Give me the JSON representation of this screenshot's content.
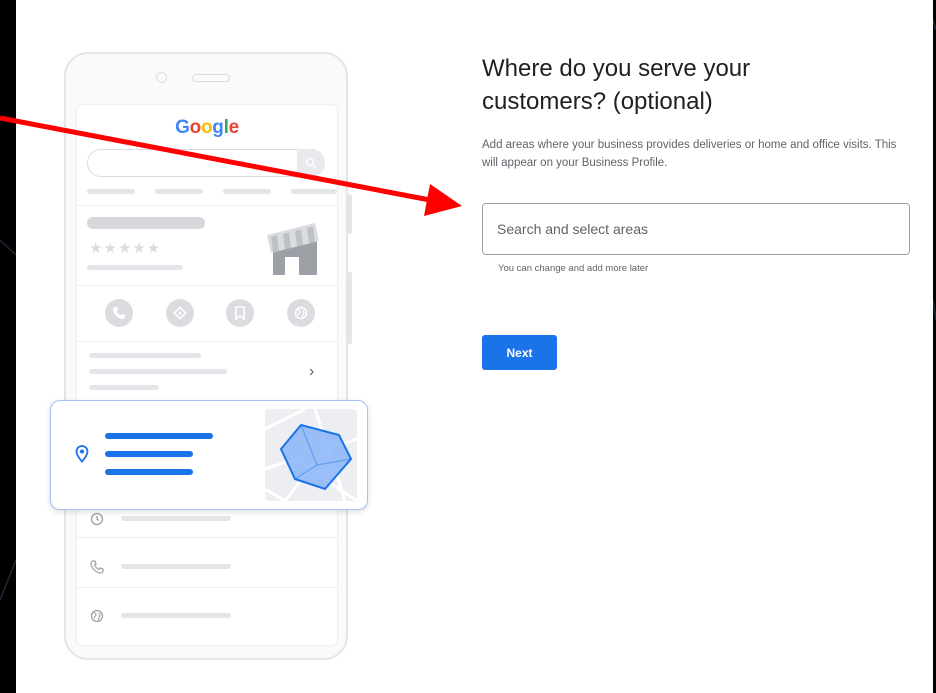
{
  "illustration": {
    "logo_text": [
      "G",
      "o",
      "o",
      "g",
      "l",
      "e"
    ],
    "stars": "★★★★★",
    "chevron": "›"
  },
  "form": {
    "title": "Where do you serve your customers? (optional)",
    "subtitle": "Add areas where your business provides deliveries or home and office visits. This will appear on your Business Profile.",
    "search": {
      "placeholder": "Search and select areas",
      "value": ""
    },
    "helper_text": "You can change and add more later",
    "next_label": "Next"
  },
  "colors": {
    "accent": "#1a73e8",
    "arrow": "#ff0000",
    "google_blue": "#4285f4",
    "google_red": "#ea4335",
    "google_yellow": "#fbbc05",
    "google_green": "#34a853"
  }
}
